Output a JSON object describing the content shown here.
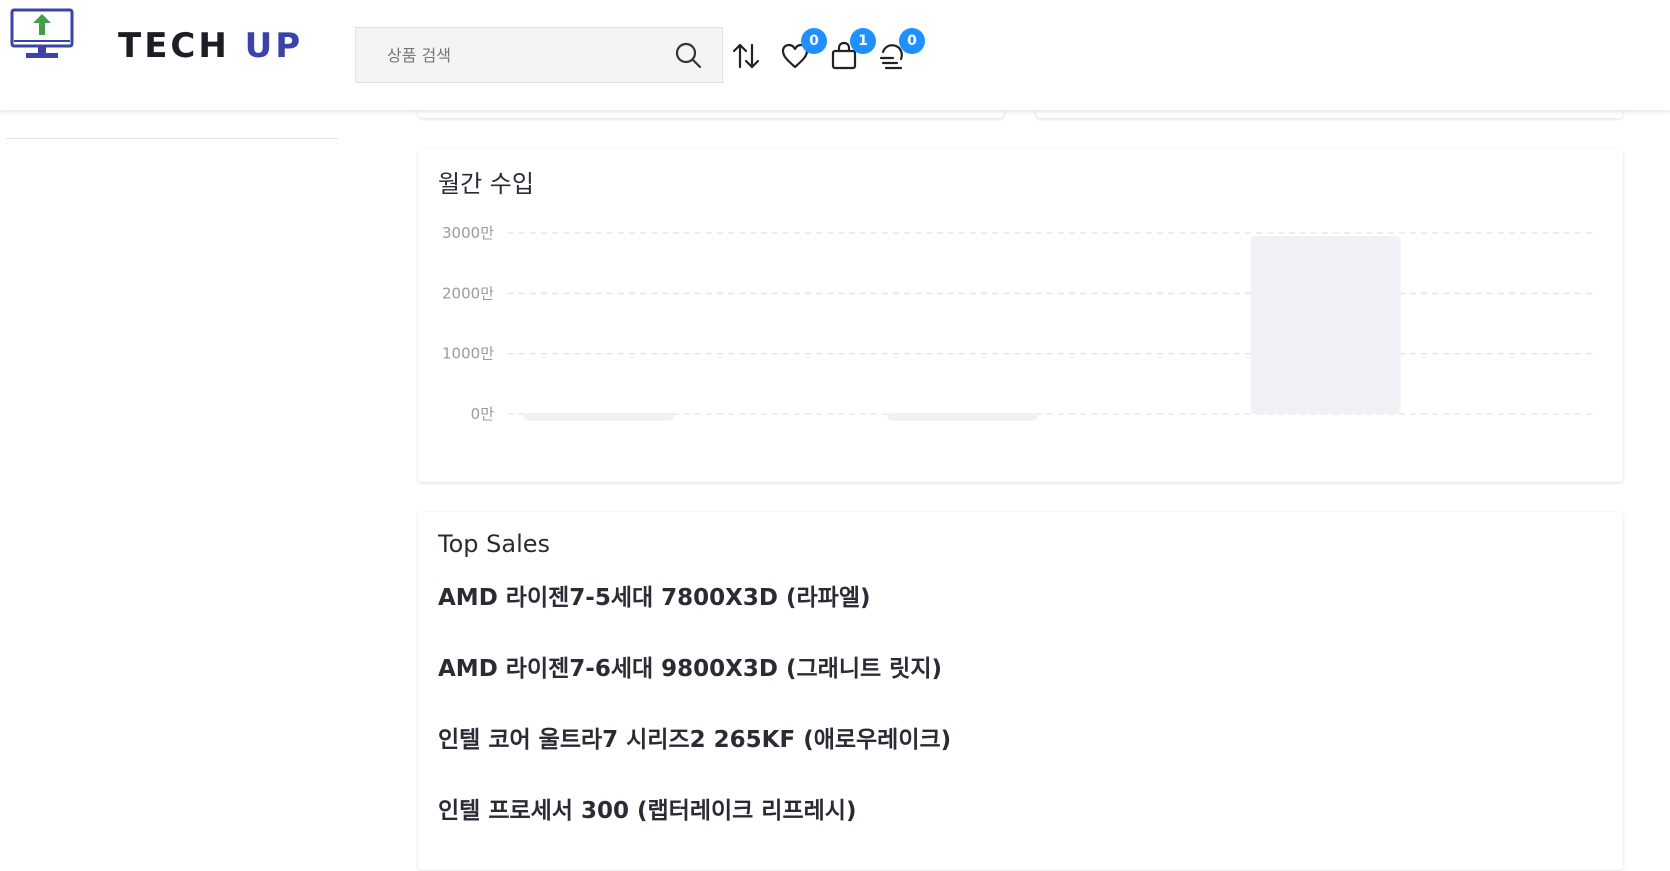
{
  "brand": {
    "name_part1": "TECH",
    "name_part2": "UP"
  },
  "search": {
    "placeholder": "상품 검색",
    "value": ""
  },
  "header_icons": {
    "compare": {
      "icon": "compare-arrows-icon"
    },
    "wishlist": {
      "icon": "heart-icon",
      "count": "0"
    },
    "cart": {
      "icon": "shopping-bag-icon",
      "count": "1"
    },
    "recent": {
      "icon": "recent-items-icon",
      "count": "0"
    }
  },
  "colors": {
    "accent": "#3b43a8",
    "badge": "#1e90ff",
    "logo_arrow": "#43a047"
  },
  "monthly_income": {
    "title": "월간 수입",
    "chart_data": {
      "type": "bar",
      "title": "월간 수입",
      "yticks": [
        "3000만",
        "2000만",
        "1000만",
        "0만"
      ],
      "ytick_values": [
        3000,
        2000,
        1000,
        0
      ],
      "ylim": [
        0,
        3000
      ],
      "values": [
        20,
        20,
        2950
      ],
      "grid": true
    }
  },
  "top_sales": {
    "title": "Top Sales",
    "items": [
      "AMD 라이젠7-5세대 7800X3D (라파엘)",
      "AMD 라이젠7-6세대 9800X3D (그래니트 릿지)",
      "인텔 코어 울트라7 시리즈2 265KF (애로우레이크)",
      "인텔 프로세서 300 (랩터레이크 리프레시)"
    ]
  }
}
